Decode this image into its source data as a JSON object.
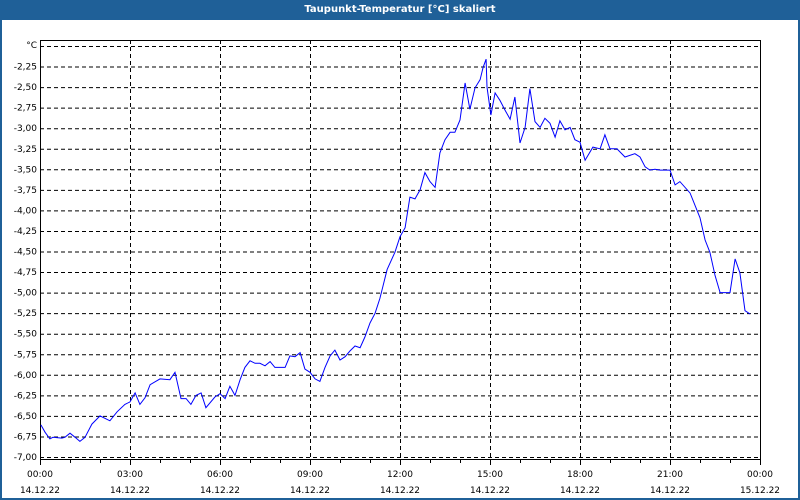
{
  "window": {
    "title": "Taupunkt-Temperatur [°C] skaliert",
    "accent": "#1f6098"
  },
  "chart_data": {
    "type": "line",
    "title": "Taupunkt-Temperatur [°C] skaliert",
    "ylabel": "°C",
    "xlabel": "",
    "ylim": [
      -7.0,
      -2.0
    ],
    "xlim_hours": [
      0,
      24
    ],
    "grid": true,
    "line_color": "#0000ff",
    "y_ticks": [
      "-2,25",
      "-2,50",
      "-2,75",
      "-3,00",
      "-3,25",
      "-3,50",
      "-3,75",
      "-4,00",
      "-4,25",
      "-4,50",
      "-4,75",
      "-5,00",
      "-5,25",
      "-5,50",
      "-5,75",
      "-6,00",
      "-6,25",
      "-6,50",
      "-6,75",
      "-7,00"
    ],
    "x_ticks": [
      {
        "time": "00:00",
        "date": "14.12.22"
      },
      {
        "time": "03:00",
        "date": "14.12.22"
      },
      {
        "time": "06:00",
        "date": "14.12.22"
      },
      {
        "time": "09:00",
        "date": "14.12.22"
      },
      {
        "time": "12:00",
        "date": "14.12.22"
      },
      {
        "time": "15:00",
        "date": "14.12.22"
      },
      {
        "time": "18:00",
        "date": "14.12.22"
      },
      {
        "time": "21:00",
        "date": "14.12.22"
      },
      {
        "time": "00:00",
        "date": "15.12.22"
      }
    ],
    "series": [
      {
        "name": "Taupunkt-Temperatur",
        "hours": [
          0.03,
          0.17,
          0.33,
          0.43,
          0.73,
          0.83,
          1.0,
          1.17,
          1.33,
          1.5,
          1.73,
          2.0,
          2.33,
          2.57,
          2.83,
          3.0,
          3.17,
          3.33,
          3.5,
          3.67,
          4.0,
          4.33,
          4.5,
          4.7,
          4.87,
          5.03,
          5.2,
          5.37,
          5.53,
          5.83,
          6.0,
          6.17,
          6.33,
          6.5,
          6.67,
          6.83,
          7.0,
          7.17,
          7.33,
          7.5,
          7.67,
          7.83,
          8.17,
          8.33,
          8.5,
          8.67,
          8.83,
          9.0,
          9.17,
          9.33,
          9.5,
          9.67,
          9.83,
          10.0,
          10.17,
          10.33,
          10.5,
          10.67,
          10.83,
          11.0,
          11.17,
          11.33,
          11.57,
          11.83,
          12.0,
          12.17,
          12.33,
          12.5,
          12.67,
          12.83,
          13.0,
          13.17,
          13.33,
          13.5,
          13.67,
          13.83,
          14.0,
          14.17,
          14.33,
          14.5,
          14.67,
          14.77,
          14.87,
          14.9,
          15.03,
          15.17,
          15.33,
          15.5,
          15.67,
          15.83,
          16.0,
          16.17,
          16.33,
          16.5,
          16.67,
          16.83,
          17.0,
          17.17,
          17.33,
          17.5,
          17.67,
          17.83,
          18.0,
          18.17,
          18.43,
          18.67,
          18.83,
          19.0,
          19.23,
          19.5,
          19.83,
          20.0,
          20.17,
          20.33,
          20.5,
          20.67,
          21.0,
          21.17,
          21.33,
          21.67,
          22.0,
          22.17,
          22.33,
          22.5,
          22.67,
          23.0,
          23.17,
          23.33,
          23.5,
          23.67,
          23.83
        ],
        "values": [
          -6.61,
          -6.7,
          -6.78,
          -6.76,
          -6.77,
          -6.76,
          -6.71,
          -6.76,
          -6.81,
          -6.76,
          -6.6,
          -6.5,
          -6.56,
          -6.45,
          -6.36,
          -6.33,
          -6.22,
          -6.36,
          -6.28,
          -6.12,
          -6.05,
          -6.06,
          -5.97,
          -6.29,
          -6.29,
          -6.36,
          -6.25,
          -6.22,
          -6.4,
          -6.27,
          -6.23,
          -6.29,
          -6.14,
          -6.25,
          -6.06,
          -5.91,
          -5.83,
          -5.86,
          -5.86,
          -5.89,
          -5.84,
          -5.91,
          -5.91,
          -5.77,
          -5.78,
          -5.73,
          -5.93,
          -5.97,
          -6.05,
          -6.08,
          -5.91,
          -5.77,
          -5.7,
          -5.82,
          -5.78,
          -5.71,
          -5.65,
          -5.67,
          -5.54,
          -5.37,
          -5.25,
          -5.07,
          -4.72,
          -4.51,
          -4.32,
          -4.21,
          -3.84,
          -3.86,
          -3.75,
          -3.54,
          -3.65,
          -3.72,
          -3.3,
          -3.14,
          -3.05,
          -3.05,
          -2.9,
          -2.45,
          -2.77,
          -2.51,
          -2.41,
          -2.26,
          -2.16,
          -2.5,
          -2.84,
          -2.57,
          -2.66,
          -2.78,
          -2.89,
          -2.62,
          -3.18,
          -2.99,
          -2.52,
          -2.92,
          -2.99,
          -2.88,
          -2.94,
          -3.11,
          -2.91,
          -3.02,
          -2.99,
          -3.14,
          -3.17,
          -3.39,
          -3.23,
          -3.25,
          -3.08,
          -3.25,
          -3.25,
          -3.35,
          -3.31,
          -3.35,
          -3.47,
          -3.51,
          -3.5,
          -3.51,
          -3.51,
          -3.69,
          -3.65,
          -3.79,
          -4.09,
          -4.36,
          -4.51,
          -4.79,
          -5.0,
          -5.0,
          -4.59,
          -4.76,
          -5.22,
          -5.26
        ]
      }
    ]
  }
}
